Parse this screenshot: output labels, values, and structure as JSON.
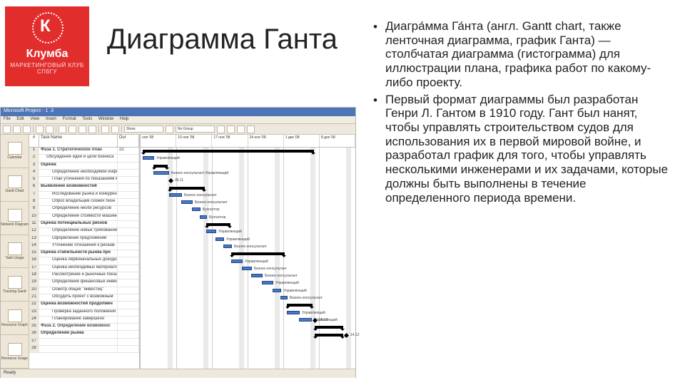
{
  "logo": {
    "letter": "К",
    "brand": "Клумба",
    "sub": "МАРКЕТИНГОВЫЙ КЛУБ СПбГУ"
  },
  "title": "Диаграмма Ганта",
  "bullets": [
    "Диагра́мма Га́нта (англ. Gantt chart, также ленточная диаграмма, график Ганта) — столбчатая диаграмма (гистограмма) для иллюстрации плана, графика работ по какому-либо проекту.",
    "Первый формат диаграммы был разработан Генри Л. Гантом в 1910 году. Гант был нанят, чтобы управлять строительством судов для использования их в первой мировой войне, и разработал график для того, чтобы управлять несколькими инженерами и их задачами, которые должны быть выполнены в течение определенного периода времени."
  ],
  "shot": {
    "title": "Microsoft Project - 1 .3",
    "menu": [
      "File",
      "Edit",
      "View",
      "Insert",
      "Format",
      "Tools",
      "Window",
      "Help"
    ],
    "toolbar": {
      "show": "Show",
      "group": "No Group"
    },
    "sidebar": [
      "Calendar",
      "Gantt Chart",
      "Network Diagram",
      "Task Usage",
      "Tracking Gantt",
      "Resource Graph",
      "Resource Usage"
    ],
    "cols": {
      "num": "#",
      "name": "Task Name",
      "dur": "Dur"
    },
    "timecols": [
      "ноя '08",
      "10 ноя '08",
      "17 ноя '08",
      "24 ноя '08",
      "1 дек '08",
      "8 дек '08"
    ],
    "rows": [
      {
        "n": "1",
        "name": "Фаза 1. Стратегическое план",
        "dur": "22",
        "type": "phase"
      },
      {
        "n": "2",
        "name": "Обсуждение идеи и цели бизнеса",
        "dur": "",
        "type": "ind1"
      },
      {
        "n": "3",
        "name": "Оценка",
        "dur": "",
        "type": "bold"
      },
      {
        "n": "4",
        "name": "Определение необходимой информ",
        "dur": "",
        "type": "ind2"
      },
      {
        "n": "5",
        "name": "План уточнения по показаниям м",
        "dur": "",
        "type": "ind2"
      },
      {
        "n": "6",
        "name": "Выявление возможностей",
        "dur": "",
        "type": "bold"
      },
      {
        "n": "7",
        "name": "Исследование рынка и конкурен",
        "dur": "",
        "type": "ind2"
      },
      {
        "n": "8",
        "name": "Опрос владельцев схожих бизн",
        "dur": "",
        "type": "ind2"
      },
      {
        "n": "9",
        "name": "Определение необх ресурсов",
        "dur": "",
        "type": "ind2"
      },
      {
        "n": "10",
        "name": "Определение стоимости машинных",
        "dur": "",
        "type": "ind2"
      },
      {
        "n": "11",
        "name": "Оценка потенциальных рисков",
        "dur": "",
        "type": "bold"
      },
      {
        "n": "12",
        "name": "Определение новых требований",
        "dur": "",
        "type": "ind2"
      },
      {
        "n": "13",
        "name": "Оформление предложений",
        "dur": "",
        "type": "ind2"
      },
      {
        "n": "14",
        "name": "Уточнение отношения к рискам",
        "dur": "",
        "type": "ind2"
      },
      {
        "n": "15",
        "name": "Оценка стабильности рынка про",
        "dur": "",
        "type": "bold"
      },
      {
        "n": "16",
        "name": "Оценка первоначальных доходов",
        "dur": "",
        "type": "ind2"
      },
      {
        "n": "17",
        "name": "Оценка необходимых материалов",
        "dur": "",
        "type": "ind2"
      },
      {
        "n": "18",
        "name": "Рассмотрение и рыночные показ",
        "dur": "",
        "type": "ind2"
      },
      {
        "n": "19",
        "name": "Определение финансовых инвестб",
        "dur": "",
        "type": "ind2"
      },
      {
        "n": "20",
        "name": "Осмотр общих \"инвестиц\"",
        "dur": "",
        "type": "ind2"
      },
      {
        "n": "21",
        "name": "Обсудить проект с возможным",
        "dur": "",
        "type": "ind2"
      },
      {
        "n": "22",
        "name": "Оценка возможностей продолжен",
        "dur": "",
        "type": "bold"
      },
      {
        "n": "23",
        "name": "Проверка заданного положения",
        "dur": "",
        "type": "ind2"
      },
      {
        "n": "24",
        "name": "Планирование завершено",
        "dur": "",
        "type": "ind2"
      },
      {
        "n": "25",
        "name": "Фаза 2. Определение возможнос",
        "dur": "",
        "type": "phase"
      },
      {
        "n": "26",
        "name": "Определение рынка",
        "dur": "",
        "type": "bold"
      },
      {
        "n": "27",
        "name": "",
        "dur": "",
        "type": ""
      },
      {
        "n": "28",
        "name": "",
        "dur": "",
        "type": ""
      }
    ],
    "ganttLabels": [
      "Управляющий",
      "Бизнес-консультант;Управляющий",
      "06.11",
      "Бизнес-консультант",
      "Бизнес-консультант",
      "Бухгалтер",
      "Бухгалтер",
      "Управляющий",
      "Управляющий",
      "Бизнес-консультант",
      "Управляющий",
      "Бизнес-консультант",
      "Бизнес-консультант",
      "Управляющий",
      "Управляющий",
      "Бизнес-консультант",
      "Управляющий",
      "Управляющий",
      "06.12",
      "14.12"
    ],
    "footer": "Ready"
  }
}
